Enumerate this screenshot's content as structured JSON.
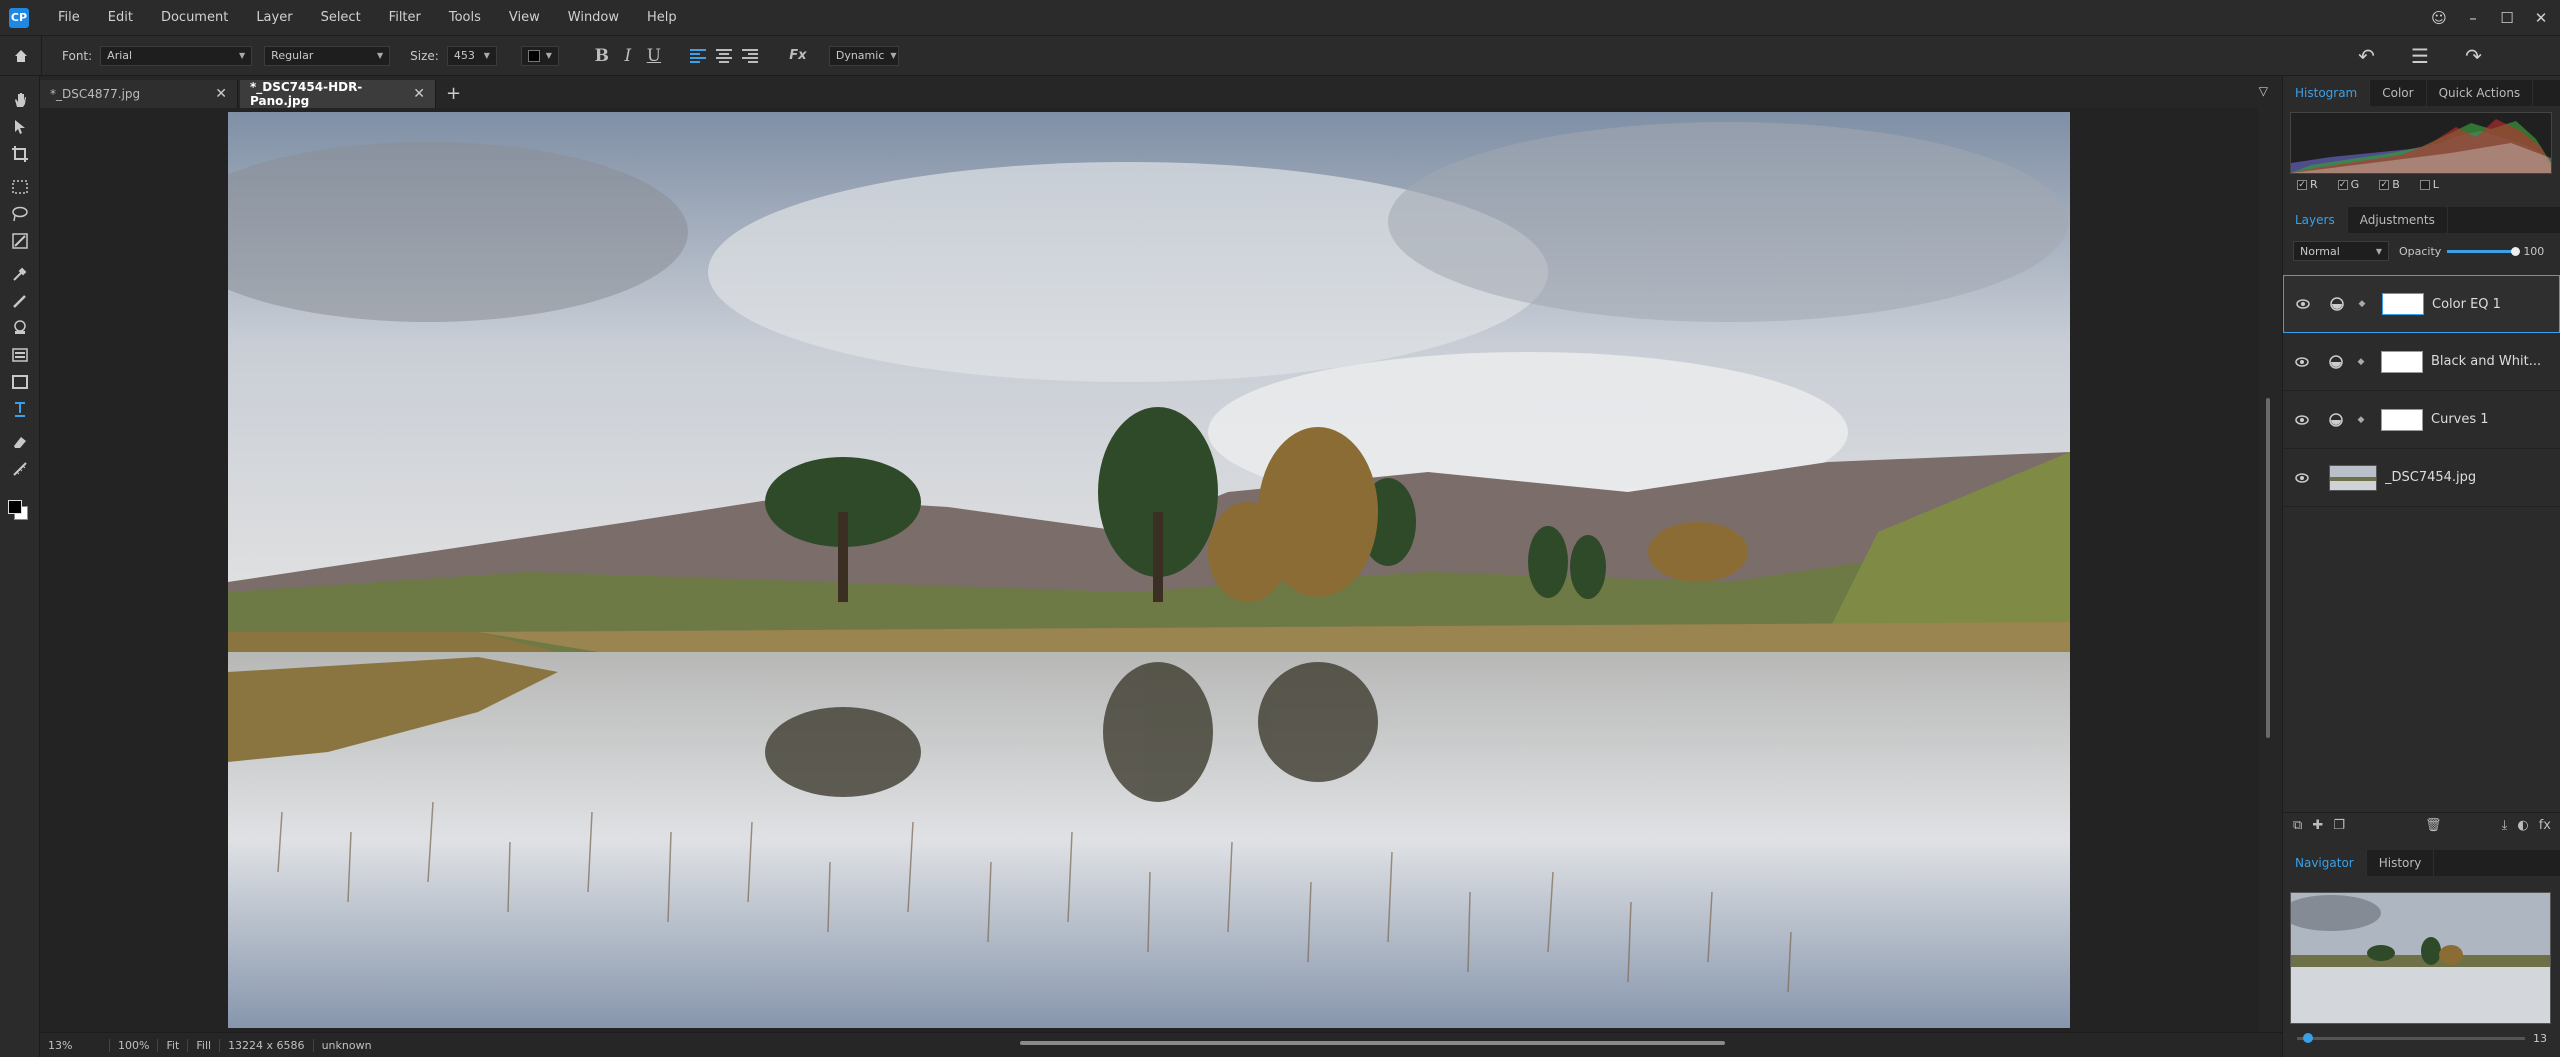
{
  "menu": [
    "File",
    "Edit",
    "Document",
    "Layer",
    "Select",
    "Filter",
    "Tools",
    "View",
    "Window",
    "Help"
  ],
  "app_logo": "CP",
  "options": {
    "font_label": "Font:",
    "font_value": "Arial",
    "style_value": "Regular",
    "size_label": "Size:",
    "size_value": "453",
    "bold": "B",
    "italic": "I",
    "underline": "U",
    "fx": "Fx",
    "mode_value": "Dynamic"
  },
  "tabs": [
    {
      "label": "*_DSC4877.jpg"
    },
    {
      "label": "*_DSC7454-HDR-Pano.jpg"
    }
  ],
  "tab_add": "+",
  "status": {
    "zoom": "13%",
    "zoom_100": "100%",
    "fit": "Fit",
    "fill": "Fill",
    "dimensions": "13224 x 6586",
    "color_profile": "unknown"
  },
  "panel_tabs_top": [
    "Histogram",
    "Color",
    "Quick Actions"
  ],
  "histogram_channels": [
    "R",
    "G",
    "B",
    "L"
  ],
  "panel_tabs_layers": [
    "Layers",
    "Adjustments"
  ],
  "blend_mode": "Normal",
  "opacity_label": "Opacity",
  "opacity_value": "100",
  "opacity_level": 1.0,
  "layers": [
    {
      "name": "Color EQ 1"
    },
    {
      "name": "Black and Whit..."
    },
    {
      "name": "Curves 1"
    },
    {
      "name": "_DSC7454.jpg"
    }
  ],
  "panel_tabs_nav": [
    "Navigator",
    "History"
  ],
  "nav_zoom_value": "13",
  "colors": {
    "accent": "#3aa0e8",
    "background": "#262626",
    "panel": "#2b2b2b"
  }
}
